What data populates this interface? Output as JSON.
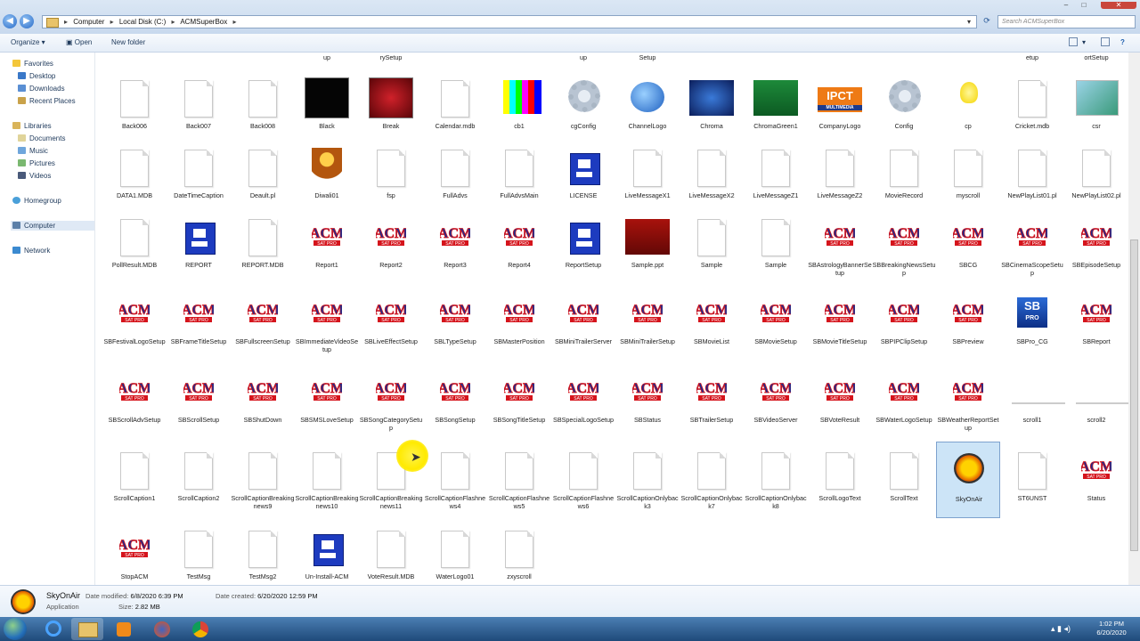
{
  "window": {
    "breadcrumbs": [
      "Computer",
      "Local Disk (C:)",
      "ACMSuperBox"
    ],
    "search_placeholder": "Search ACMSuperBox",
    "refresh_icon": "refresh-icon"
  },
  "toolbar": {
    "organize": "Organize ▾",
    "open": "Open",
    "new_folder": "New folder"
  },
  "sidebar": {
    "favorites": "Favorites",
    "desktop": "Desktop",
    "downloads": "Downloads",
    "recent_places": "Recent Places",
    "libraries": "Libraries",
    "documents": "Documents",
    "music": "Music",
    "pictures": "Pictures",
    "videos": "Videos",
    "homegroup": "Homegroup",
    "computer": "Computer",
    "network": "Network"
  },
  "top_partial_labels": [
    "up",
    "rySetup",
    "up",
    "Setup",
    "etup",
    "ortSetup"
  ],
  "rows": [
    [
      {
        "name": "Back006",
        "icon": "doc"
      },
      {
        "name": "Back007",
        "icon": "doc"
      },
      {
        "name": "Back008",
        "icon": "doc"
      },
      {
        "name": "Black",
        "icon": "black"
      },
      {
        "name": "Break",
        "icon": "red"
      },
      {
        "name": "Calendar.mdb",
        "icon": "doc"
      },
      {
        "name": "cb1",
        "icon": "bars"
      },
      {
        "name": "cgConfig",
        "icon": "gear"
      },
      {
        "name": "ChannelLogo",
        "icon": "globe"
      },
      {
        "name": "Chroma",
        "icon": "blue"
      },
      {
        "name": "ChromaGreen1",
        "icon": "green"
      },
      {
        "name": "CompanyLogo",
        "icon": "ipct"
      },
      {
        "name": "Config",
        "icon": "gear"
      },
      {
        "name": "cp",
        "icon": "bulb"
      },
      {
        "name": "Cricket.mdb",
        "icon": "doc"
      },
      {
        "name": "csr",
        "icon": "csr"
      }
    ],
    [
      {
        "name": "DATA1.MDB",
        "icon": "doc"
      },
      {
        "name": "DateTimeCaption",
        "icon": "doc"
      },
      {
        "name": "Deault.pl",
        "icon": "doc"
      },
      {
        "name": "Diwali01",
        "icon": "diwali"
      },
      {
        "name": "fsp",
        "icon": "doc"
      },
      {
        "name": "FullAdvs",
        "icon": "doc"
      },
      {
        "name": "FullAdvsMain",
        "icon": "doc"
      },
      {
        "name": "LICENSE",
        "icon": "comp"
      },
      {
        "name": "LiveMessageX1",
        "icon": "doc"
      },
      {
        "name": "LiveMessageX2",
        "icon": "doc"
      },
      {
        "name": "LiveMessageZ1",
        "icon": "doc"
      },
      {
        "name": "LiveMessageZ2",
        "icon": "doc"
      },
      {
        "name": "MovieRecord",
        "icon": "doc"
      },
      {
        "name": "myscroll",
        "icon": "doc"
      },
      {
        "name": "NewPlayList01.pl",
        "icon": "doc"
      },
      {
        "name": "NewPlayList02.pl",
        "icon": "doc"
      }
    ],
    [
      {
        "name": "PollResult.MDB",
        "icon": "doc"
      },
      {
        "name": "REPORT",
        "icon": "comp"
      },
      {
        "name": "REPORT.MDB",
        "icon": "doc"
      },
      {
        "name": "Report1",
        "icon": "acm"
      },
      {
        "name": "Report2",
        "icon": "acm"
      },
      {
        "name": "Report3",
        "icon": "acm"
      },
      {
        "name": "Report4",
        "icon": "acm"
      },
      {
        "name": "ReportSetup",
        "icon": "comp"
      },
      {
        "name": "Sample.ppt",
        "icon": "sun"
      },
      {
        "name": "Sample",
        "icon": "doc"
      },
      {
        "name": "Sample",
        "icon": "doc"
      },
      {
        "name": "SBAstrologyBannerSetup",
        "icon": "acm"
      },
      {
        "name": "SBBreakingNewsSetup",
        "icon": "acm"
      },
      {
        "name": "SBCG",
        "icon": "acm"
      },
      {
        "name": "SBCinemaScopeSetup",
        "icon": "acm"
      },
      {
        "name": "SBEpisodeSetup",
        "icon": "acm"
      }
    ],
    [
      {
        "name": "SBFestivalLogoSetup",
        "icon": "acm"
      },
      {
        "name": "SBFrameTitleSetup",
        "icon": "acm"
      },
      {
        "name": "SBFullscreenSetup",
        "icon": "acm"
      },
      {
        "name": "SBImmediateVideoSetup",
        "icon": "acm"
      },
      {
        "name": "SBLiveEffectSetup",
        "icon": "acm"
      },
      {
        "name": "SBLTypeSetup",
        "icon": "acm"
      },
      {
        "name": "SBMasterPosition",
        "icon": "acm"
      },
      {
        "name": "SBMiniTrailerServer",
        "icon": "acm"
      },
      {
        "name": "SBMiniTrailerSetup",
        "icon": "acm"
      },
      {
        "name": "SBMovieList",
        "icon": "acm"
      },
      {
        "name": "SBMovieSetup",
        "icon": "acm"
      },
      {
        "name": "SBMovieTitleSetup",
        "icon": "acm"
      },
      {
        "name": "SBPIPClipSetup",
        "icon": "acm"
      },
      {
        "name": "SBPreview",
        "icon": "acm"
      },
      {
        "name": "SBPro_CG",
        "icon": "sbpro"
      },
      {
        "name": "SBReport",
        "icon": "acm"
      }
    ],
    [
      {
        "name": "SBScrollAdvSetup",
        "icon": "acm"
      },
      {
        "name": "SBScrollSetup",
        "icon": "acm"
      },
      {
        "name": "SBShutDown",
        "icon": "acm"
      },
      {
        "name": "SBSMSLoveSetup",
        "icon": "acm"
      },
      {
        "name": "SBSongCategorySetup",
        "icon": "acm"
      },
      {
        "name": "SBSongSetup",
        "icon": "acm"
      },
      {
        "name": "SBSongTitleSetup",
        "icon": "acm"
      },
      {
        "name": "SBSpecialLogoSetup",
        "icon": "acm"
      },
      {
        "name": "SBStatus",
        "icon": "acm"
      },
      {
        "name": "SBTrailerSetup",
        "icon": "acm"
      },
      {
        "name": "SBVideoServer",
        "icon": "acm"
      },
      {
        "name": "SBVoteResult",
        "icon": "acm"
      },
      {
        "name": "SBWaterLogoSetup",
        "icon": "acm"
      },
      {
        "name": "SBWeatherReportSetup",
        "icon": "acm"
      },
      {
        "name": "scroll1",
        "icon": "line"
      },
      {
        "name": "scroll2",
        "icon": "line"
      }
    ],
    [
      {
        "name": "ScrollCaption1",
        "icon": "doc"
      },
      {
        "name": "ScrollCaption2",
        "icon": "doc"
      },
      {
        "name": "ScrollCaptionBreakingnews9",
        "icon": "doc"
      },
      {
        "name": "ScrollCaptionBreakingnews10",
        "icon": "doc"
      },
      {
        "name": "ScrollCaptionBreakingnews11",
        "icon": "doc"
      },
      {
        "name": "ScrollCaptionFlashnews4",
        "icon": "doc"
      },
      {
        "name": "ScrollCaptionFlashnews5",
        "icon": "doc"
      },
      {
        "name": "ScrollCaptionFlashnews6",
        "icon": "doc"
      },
      {
        "name": "ScrollCaptionOnlyback3",
        "icon": "doc"
      },
      {
        "name": "ScrollCaptionOnlyback7",
        "icon": "doc"
      },
      {
        "name": "ScrollCaptionOnlyback8",
        "icon": "doc"
      },
      {
        "name": "ScrollLogoText",
        "icon": "doc"
      },
      {
        "name": "ScrollText",
        "icon": "doc"
      },
      {
        "name": "SkyOnAir",
        "icon": "sky",
        "selected": true
      },
      {
        "name": "ST6UNST",
        "icon": "doc"
      },
      {
        "name": "Status",
        "icon": "acm"
      }
    ],
    [
      {
        "name": "StopACM",
        "icon": "acm"
      },
      {
        "name": "TestMsg",
        "icon": "doc"
      },
      {
        "name": "TestMsg2",
        "icon": "doc"
      },
      {
        "name": "Un-Install-ACM",
        "icon": "comp"
      },
      {
        "name": "VoteResult.MDB",
        "icon": "doc"
      },
      {
        "name": "WaterLogo01",
        "icon": "doc"
      },
      {
        "name": "zxyscroll",
        "icon": "doc"
      }
    ]
  ],
  "acm_text": "ACM",
  "acm_sub": "SAT PRO",
  "ipct_text": "IPCT",
  "ipct_sub": "MULTIMEDIA",
  "sbpro_text": "SB",
  "sbpro_sub": "PRO",
  "details": {
    "name": "SkyOnAir",
    "type": "Application",
    "modified_label": "Date modified:",
    "modified": "6/8/2020 6:39 PM",
    "size_label": "Size:",
    "size": "2.82 MB",
    "created_label": "Date created:",
    "created": "6/20/2020 12:59 PM"
  },
  "clock": {
    "time": "1:02 PM",
    "date": "6/20/2020"
  },
  "colors": {
    "acm_blue": "#1c2d8f",
    "acm_red": "#d5141c",
    "selection": "#cce4f7"
  }
}
